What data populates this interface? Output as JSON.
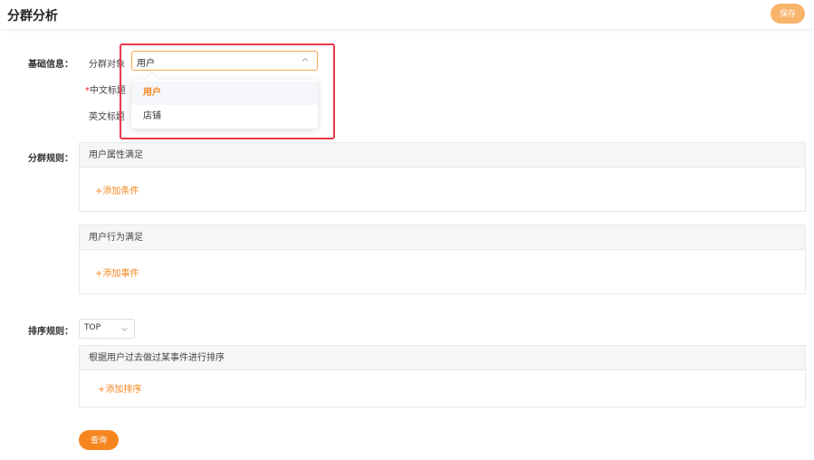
{
  "header": {
    "title": "分群分析",
    "save_label": "保存"
  },
  "basic_info": {
    "section_label": "基础信息：",
    "target_label": "分群对象",
    "target_value": "用户",
    "cn_title_required_mark": "*",
    "cn_title_label": "中文标题",
    "en_title_label": "英文标题",
    "dropdown_options": [
      "用户",
      "店铺"
    ]
  },
  "group_rules": {
    "section_label": "分群规则：",
    "user_attr_title": "用户属性满足",
    "add_condition_label": "+添加条件",
    "user_behavior_title": "用户行为满足",
    "add_event_label": "+添加事件"
  },
  "sort_rules": {
    "section_label": "排序规则：",
    "select_value": "TOP",
    "panel_title": "根据用户过去做过某事件进行排序",
    "add_sort_label": "+添加排序"
  },
  "query_label": "查询",
  "colors": {
    "accent": "#f5861f",
    "save_button": "#f7b46a",
    "highlight": "#e8394a"
  }
}
